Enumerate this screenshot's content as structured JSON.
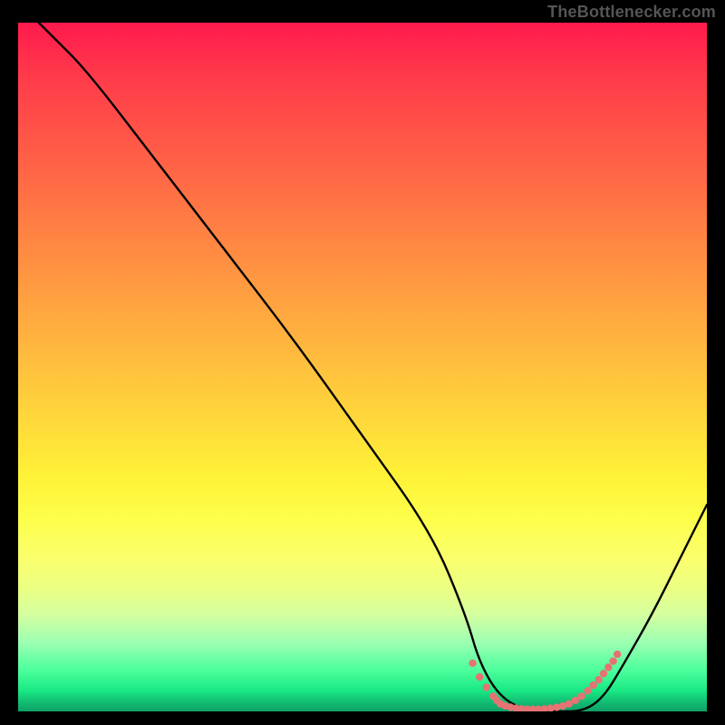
{
  "watermark": "TheBottlenecker.com",
  "chart_data": {
    "type": "line",
    "title": "",
    "xlabel": "",
    "ylabel": "",
    "xlim": [
      0,
      100
    ],
    "ylim": [
      0,
      100
    ],
    "background": "rainbow-vertical-red-to-green",
    "series": [
      {
        "name": "bottleneck-curve",
        "x": [
          3,
          5,
          10,
          20,
          30,
          40,
          50,
          60,
          65,
          67,
          70,
          74,
          78,
          82,
          85,
          88,
          92,
          96,
          100
        ],
        "y": [
          100,
          98,
          93,
          80,
          67,
          54,
          40,
          26,
          14,
          7,
          2,
          0,
          0,
          0,
          2,
          7,
          14,
          22,
          30
        ]
      }
    ],
    "markers": {
      "name": "optimal-range-dots",
      "color": "#e57373",
      "points_x": [
        66,
        67,
        68,
        69,
        69.5,
        70,
        70.7,
        71.5,
        72.3,
        73.1,
        73.9,
        74.7,
        75.5,
        76.4,
        77.3,
        78.2,
        79.1,
        80,
        80.9,
        81.8,
        82.7,
        83.5,
        84.3,
        85,
        85.7,
        86.4,
        87
      ],
      "points_y": [
        7,
        5,
        3.5,
        2.2,
        1.6,
        1.1,
        0.8,
        0.6,
        0.45,
        0.35,
        0.3,
        0.3,
        0.3,
        0.35,
        0.45,
        0.6,
        0.8,
        1.1,
        1.6,
        2.2,
        3.0,
        3.8,
        4.6,
        5.5,
        6.4,
        7.3,
        8.3
      ]
    }
  }
}
